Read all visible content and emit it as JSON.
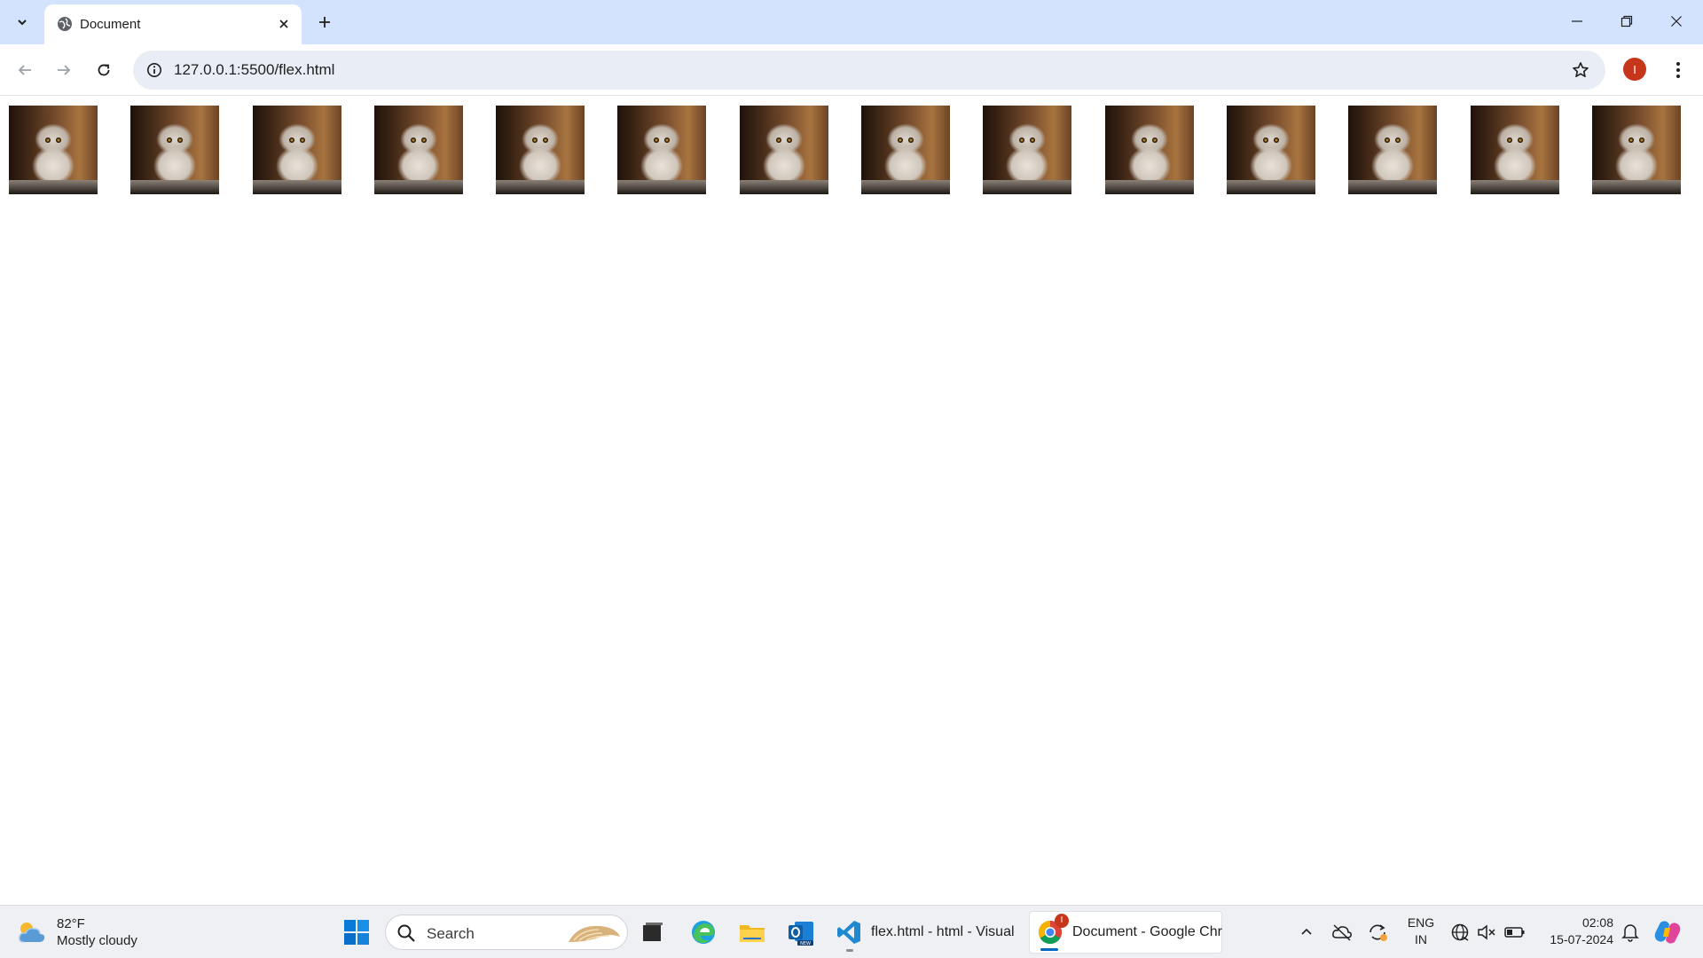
{
  "browser": {
    "tab": {
      "title": "Document"
    },
    "url": "127.0.0.1:5500/flex.html",
    "profile_initial": "I",
    "profile_color": "#c5361b"
  },
  "page": {
    "images": [
      {
        "alt": "cat"
      },
      {
        "alt": "cat"
      },
      {
        "alt": "cat"
      },
      {
        "alt": "cat"
      },
      {
        "alt": "cat"
      },
      {
        "alt": "cat"
      },
      {
        "alt": "cat"
      },
      {
        "alt": "cat"
      },
      {
        "alt": "cat"
      },
      {
        "alt": "cat"
      },
      {
        "alt": "cat"
      },
      {
        "alt": "cat"
      },
      {
        "alt": "cat"
      },
      {
        "alt": "cat"
      }
    ]
  },
  "taskbar": {
    "weather": {
      "temp": "82°F",
      "condition": "Mostly cloudy",
      "icon": "partly-cloudy-icon"
    },
    "search_label": "Search",
    "apps": {
      "vscode_label": "flex.html - html - Visual",
      "chrome_label": "Document - Google Chr",
      "chrome_badge": "I"
    },
    "tray": {
      "lang_line1": "ENG",
      "lang_line2": "IN",
      "time": "02:08",
      "date": "15-07-2024"
    }
  },
  "colors": {
    "tabstrip": "#d3e3fd",
    "omnibox": "#e9eef6",
    "taskbar": "#eef0f4",
    "accent_blue": "#0067c0"
  }
}
